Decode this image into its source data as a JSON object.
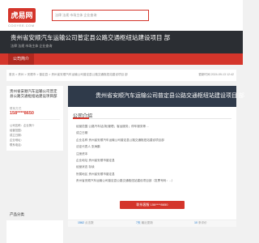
{
  "header": {
    "logo_text": "虎易网",
    "logo_sub": "COOYEE.COM",
    "search_placeholder": "法律 法规 市场主体 企业查询"
  },
  "banner": {
    "title": "贵州省安顺汽车运输公司普定县公路交通枢纽站建设项目 部",
    "subtitle": "法律 法规 市场主体 企业查询"
  },
  "nav": {
    "active_label": "公司简介"
  },
  "breadcrumb": {
    "path": "首页 > 贵州 > 安顺市 > 普定县 > 贵州省安顺汽车运输公司普定县公路交通枢纽站建设项目 部",
    "updated": "更新时间 2024-09-13 12:42"
  },
  "left": {
    "title": "贵州省安顺汽车运输公司普定县公路交通枢纽站建设项目部",
    "contact_label": "联系方式",
    "phone": "158****8650",
    "rows": [
      "公司名称：企业简介",
      "经营范围：",
      "成立日期：",
      "企业地址：",
      "联系电话："
    ]
  },
  "main": {
    "header_title": "贵州省安顺汽车运输公司普定县公路交通枢纽站建设项目 部",
    "section_title": "公司介绍",
    "info_rows": [
      "经营范围 公路汽车站(场)管理；客运服务；停车服务等 ...",
      "成立日期",
      "企业名称 贵州省安顺汽车运输公司普定县公路交通枢纽站建设项目部",
      "法定代表人 张海鹏",
      "注册资本",
      "企业地址 贵州省安顺市普定县",
      "经营状态 存续",
      "所属地区 贵州省安顺市普定县",
      "贵州省安顺汽车运输公司普定县公路交通枢纽站建设项目部（发票号码：...）"
    ],
    "contact_button": "联系客服 158****8650"
  },
  "stats": {
    "s1_num": "1562",
    "s1_label": "点击数",
    "s2_num": "7天",
    "s2_label": "最近更新",
    "s3_num": "10",
    "s3_label": "条评价"
  },
  "side": {
    "label": "产品分类"
  },
  "colors": {
    "brand_red": "#d4352b",
    "dark_banner": "#2b2e33",
    "header_navy": "#2f3a4a"
  }
}
